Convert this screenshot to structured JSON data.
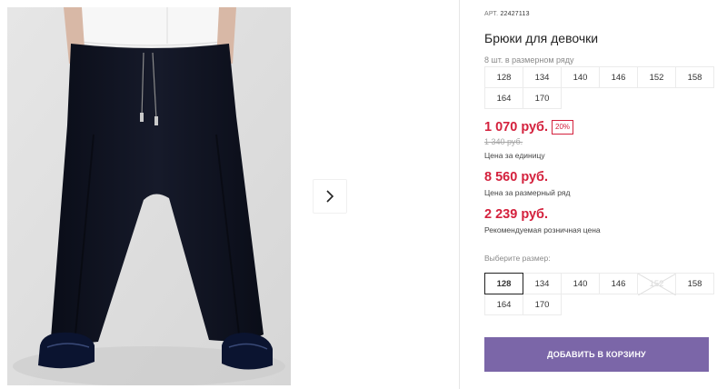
{
  "gallery": {
    "image_alt": "Брюки для девочки",
    "next_icon": "chevron-right-icon"
  },
  "product": {
    "art_label": "АРТ.",
    "art_number": "22427113",
    "title": "Брюки для девочки",
    "series_note": "8 шт. в размерном ряду",
    "series_sizes": [
      "128",
      "134",
      "140",
      "146",
      "152",
      "158",
      "164",
      "170"
    ]
  },
  "pricing": {
    "unit_price": "1 070 руб.",
    "discount_badge": "20%",
    "old_price": "1 340 руб.",
    "unit_caption": "Цена за единицу",
    "series_price": "8 560 руб.",
    "series_caption": "Цена за размерный ряд",
    "retail_price": "2 239 руб.",
    "retail_caption": "Рекомендуемая розничная цена",
    "price_color": "#d4213d"
  },
  "size_selector": {
    "label": "Выберите размер:",
    "sizes": [
      {
        "label": "128",
        "state": "selected"
      },
      {
        "label": "134",
        "state": "available"
      },
      {
        "label": "140",
        "state": "available"
      },
      {
        "label": "146",
        "state": "available"
      },
      {
        "label": "152",
        "state": "unavailable"
      },
      {
        "label": "158",
        "state": "available"
      },
      {
        "label": "164",
        "state": "available"
      },
      {
        "label": "170",
        "state": "available"
      }
    ]
  },
  "cart": {
    "add_label": "ДОБАВИТЬ В КОРЗИНУ",
    "button_color": "#7b66a8"
  }
}
